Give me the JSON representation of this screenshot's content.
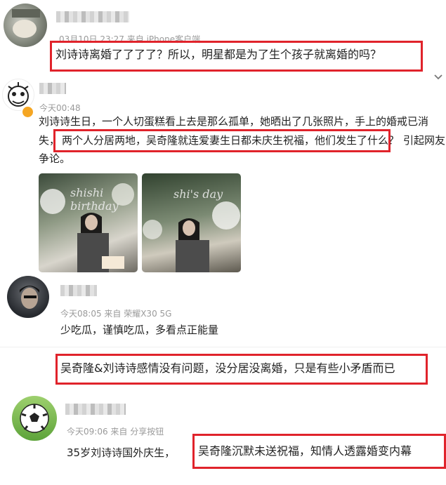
{
  "comment1": {
    "meta": "03月10日 23:27 来自 iPhone客户端",
    "text": "刘诗诗离婚了了了了？所以，明星都是为了生个孩子就离婚的吗？"
  },
  "post": {
    "meta": "今天00:48",
    "line1": "刘诗诗生日，一个人切蛋糕看上去是那么孤单，她晒出了几张照片，手上的婚戒已消",
    "line2_pre": "失，",
    "line2_highlight": "两个人分居两地，吴奇隆就连爱妻生日都未庆生祝福，他们发生了什么？",
    "line2_post": "引起网友",
    "line3": "争论。",
    "photo1_text": "shishi birthday",
    "photo2_text": "shi's day"
  },
  "comment2": {
    "meta": "今天08:05 来自 荣耀X30 5G",
    "text": "少吃瓜，谨慎吃瓜，多看点正能量",
    "highlight": "吴奇隆&刘诗诗感情没有问题，没分居没离婚，只是有些小矛盾而已"
  },
  "comment3": {
    "meta": "今天09:06 来自 分享按钮",
    "pre": "35岁刘诗诗国外庆生，",
    "highlight": "吴奇隆沉默未送祝福，知情人透露婚变内幕"
  },
  "icons": [
    "chevron-down-icon",
    "verified-badge-icon"
  ],
  "colors": {
    "highlight_border": "#e0232b",
    "meta": "#9a9a9a",
    "verified": "#f5a623"
  }
}
